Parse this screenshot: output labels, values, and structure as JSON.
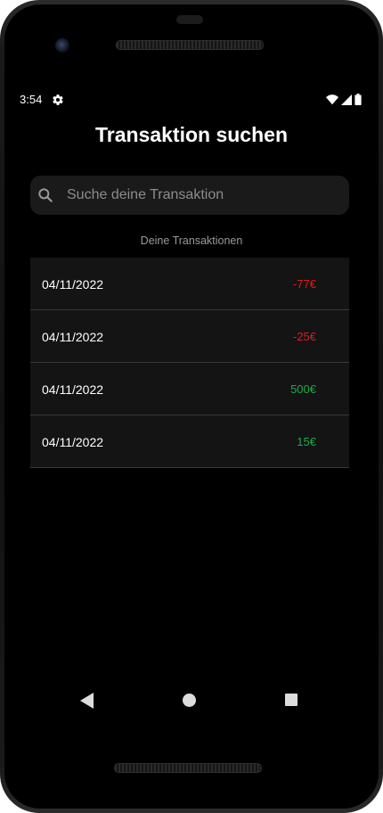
{
  "status_bar": {
    "time": "3:54",
    "icons": [
      "gear-icon",
      "wifi-icon",
      "cell-signal-icon",
      "battery-icon"
    ]
  },
  "page": {
    "title": "Transaktion suchen"
  },
  "search": {
    "placeholder": "Suche deine Transaktion",
    "value": ""
  },
  "list": {
    "header": "Deine Transaktionen",
    "items": [
      {
        "date": "04/11/2022",
        "amount": "-77€",
        "type": "expense"
      },
      {
        "date": "04/11/2022",
        "amount": "-25€",
        "type": "expense"
      },
      {
        "date": "04/11/2022",
        "amount": "500€",
        "type": "income"
      },
      {
        "date": "04/11/2022",
        "amount": "15€",
        "type": "income"
      }
    ]
  },
  "colors": {
    "background": "#000000",
    "row_background": "#141414",
    "expense": "#e01b1b",
    "income": "#1fa84a",
    "muted_text": "#9a9a9a"
  },
  "nav_bar": {
    "icons": [
      "back-icon",
      "home-icon",
      "recents-icon"
    ]
  }
}
